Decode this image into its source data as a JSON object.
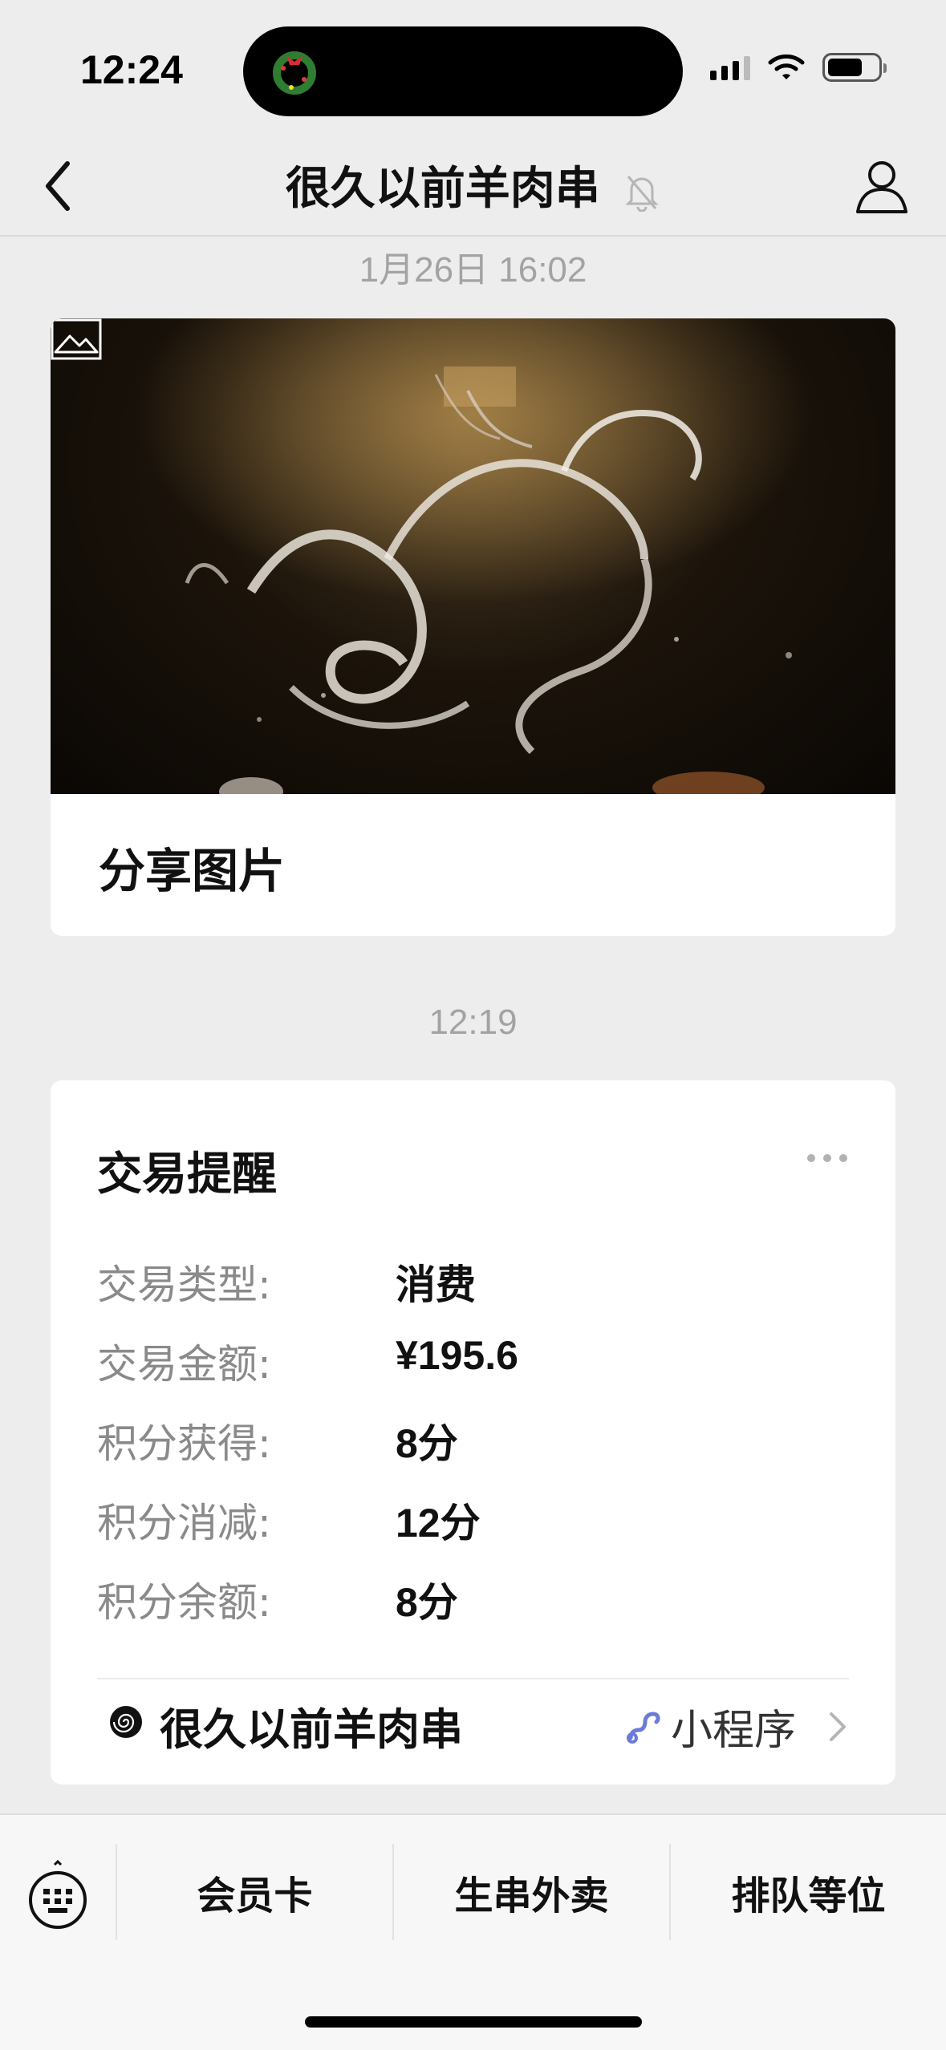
{
  "status_bar": {
    "time": "12:24",
    "battery_level": 0.7
  },
  "nav": {
    "title": "很久以前羊肉串"
  },
  "messages": {
    "timestamp_1": "1月26日 16:02",
    "share_card_label": "分享图片",
    "timestamp_2": "12:19"
  },
  "transaction": {
    "title": "交易提醒",
    "rows": [
      {
        "label": "交易类型:",
        "value": "消费"
      },
      {
        "label": "交易金额:",
        "value": "¥195.6"
      },
      {
        "label": "积分获得:",
        "value": "8分"
      },
      {
        "label": "积分消减:",
        "value": "12分"
      },
      {
        "label": "积分余额:",
        "value": "8分"
      }
    ],
    "footer_name": "很久以前羊肉串",
    "footer_tag": "小程序"
  },
  "bottom_menu": {
    "items": [
      "会员卡",
      "生串外卖",
      "排队等位"
    ]
  },
  "colors": {
    "background": "#ededed",
    "card": "#ffffff",
    "muted_text": "#8a8a8a",
    "mini_program_accent": "#6b7bd6"
  }
}
